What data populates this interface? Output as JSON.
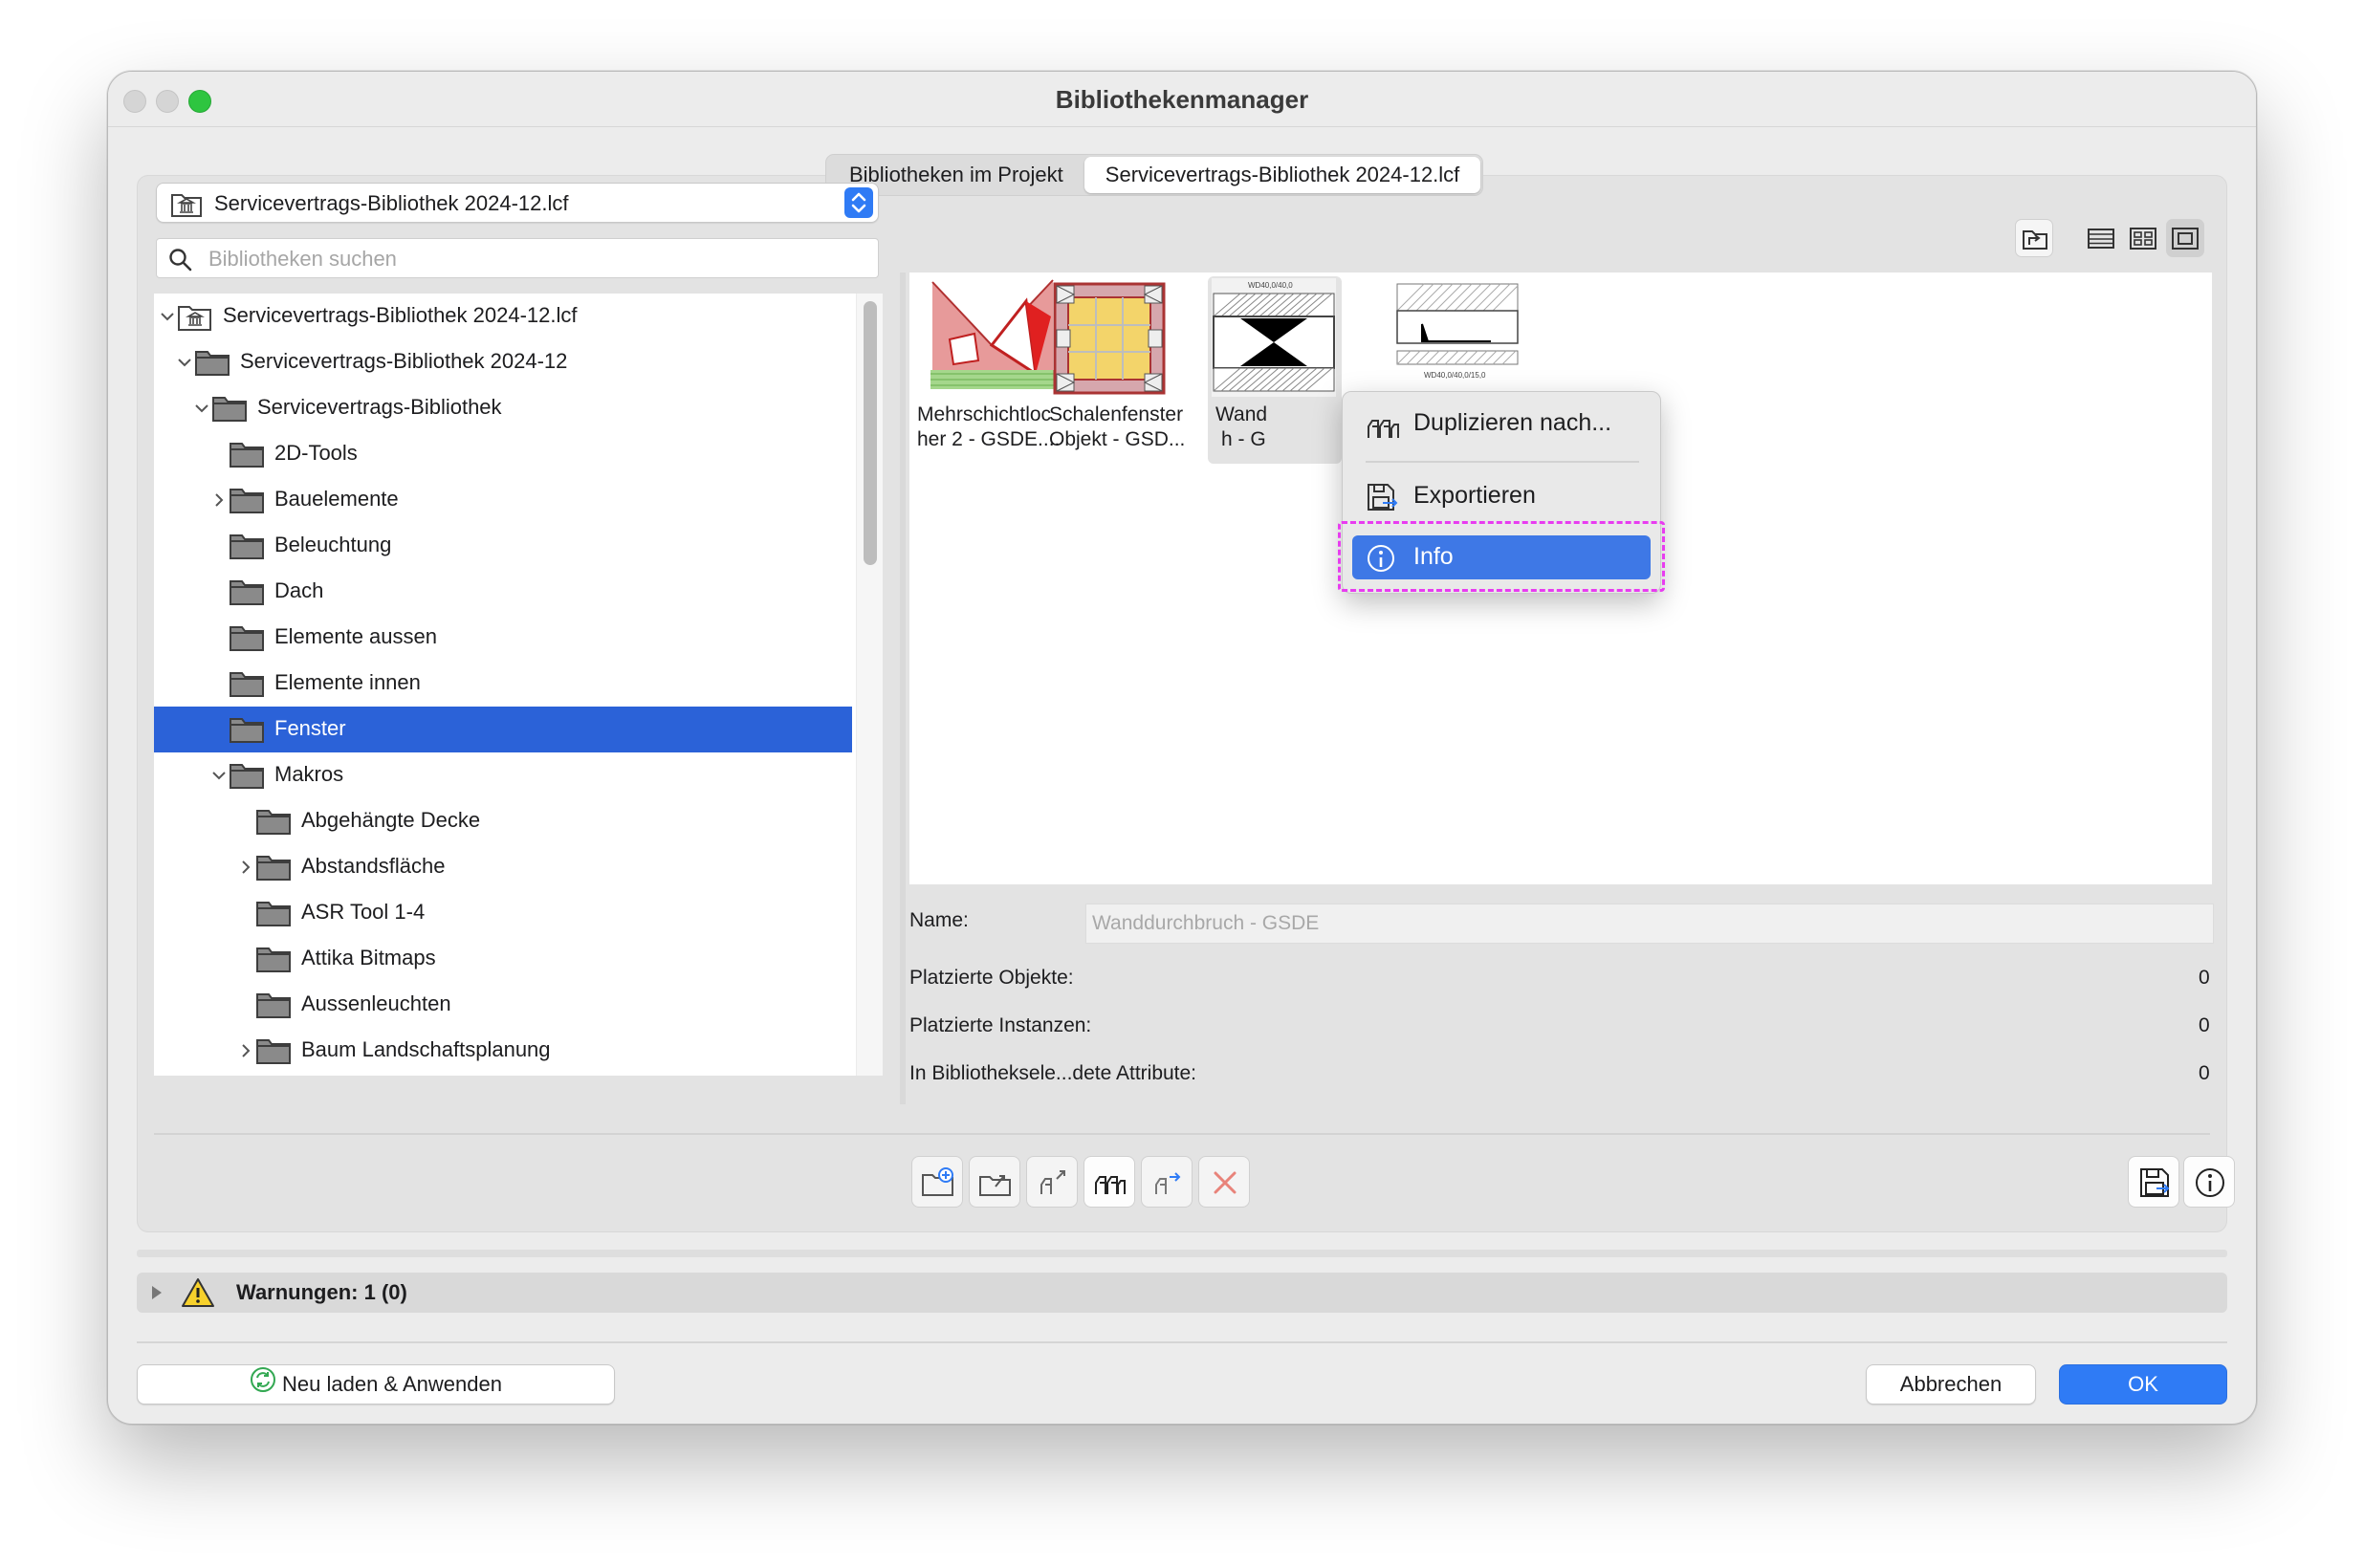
{
  "window": {
    "title": "Bibliothekenmanager"
  },
  "tabs": [
    {
      "label": "Bibliotheken im Projekt",
      "active": false
    },
    {
      "label": "Servicevertrags-Bibliothek 2024-12.lcf",
      "active": true
    }
  ],
  "library_select": {
    "value": "Servicevertrags-Bibliothek 2024-12.lcf"
  },
  "search": {
    "placeholder": "Bibliotheken suchen"
  },
  "tree": {
    "items": [
      {
        "label": "Servicevertrags-Bibliothek 2024-12.lcf",
        "expanded": true,
        "icon": "library-icon"
      },
      {
        "label": "Servicevertrags-Bibliothek 2024-12",
        "expanded": true,
        "icon": "folder-icon"
      },
      {
        "label": "Servicevertrags-Bibliothek",
        "expanded": true,
        "icon": "folder-icon"
      },
      {
        "label": "2D-Tools",
        "icon": "folder-icon"
      },
      {
        "label": "Bauelemente",
        "expanded": false,
        "icon": "folder-icon"
      },
      {
        "label": "Beleuchtung",
        "icon": "folder-icon"
      },
      {
        "label": "Dach",
        "icon": "folder-icon"
      },
      {
        "label": "Elemente aussen",
        "icon": "folder-icon"
      },
      {
        "label": "Elemente innen",
        "icon": "folder-icon"
      },
      {
        "label": "Fenster",
        "selected": true,
        "icon": "folder-icon"
      },
      {
        "label": "Makros",
        "expanded": true,
        "icon": "folder-icon"
      },
      {
        "label": "Abgehängte Decke",
        "icon": "folder-icon"
      },
      {
        "label": "Abstandsfläche",
        "expanded": false,
        "icon": "folder-icon"
      },
      {
        "label": "ASR Tool 1-4",
        "icon": "folder-icon"
      },
      {
        "label": "Attika Bitmaps",
        "icon": "folder-icon"
      },
      {
        "label": "Aussenleuchten",
        "icon": "folder-icon"
      },
      {
        "label": "Baum Landschaftsplanung",
        "expanded": false,
        "icon": "folder-icon"
      }
    ]
  },
  "view_buttons": [
    "folder-up-icon",
    "list-view-icon",
    "grid-view-icon",
    "preview-view-icon"
  ],
  "preview": {
    "items": [
      {
        "caption_line1": "Mehrschichtloc",
        "caption_line2": "her 2 - GSDE....",
        "thumb_label": ""
      },
      {
        "caption_line1": "Schalenfenster",
        "caption_line2": "Objekt - GSD...",
        "thumb_label": ""
      },
      {
        "caption_line1": "Wand",
        "caption_line2": "h  - G",
        "thumb_label": "WD40,0/40,0"
      },
      {
        "caption_line1": "",
        "caption_line2": "",
        "thumb_label": "WD40,0/40,0/15,0"
      }
    ]
  },
  "context_menu": {
    "items": [
      {
        "label": "Duplizieren nach...",
        "icon": "duplicate-icon"
      },
      {
        "label": "Exportieren",
        "icon": "export-icon"
      },
      {
        "label": "Info",
        "icon": "info-icon",
        "highlighted": true
      }
    ]
  },
  "details": {
    "name_label": "Name:",
    "name_value": "Wanddurchbruch  - GSDE",
    "rows": [
      {
        "label": "Platzierte Objekte:",
        "value": "0"
      },
      {
        "label": "Platzierte Instanzen:",
        "value": "0"
      },
      {
        "label": "In Bibliotheksele...dete Attribute:",
        "value": "0"
      }
    ]
  },
  "toolbar": {
    "buttons": [
      "new-folder-icon",
      "open-folder-icon",
      "move-objects-icon",
      "duplicate-objects-icon",
      "move-to-icon",
      "delete-icon"
    ],
    "right_buttons": [
      "save-export-icon",
      "info-icon"
    ]
  },
  "warnings": {
    "label": "Warnungen: 1 (0)"
  },
  "footer": {
    "reload_label": "Neu laden & Anwenden",
    "cancel_label": "Abbrechen",
    "ok_label": "OK"
  },
  "colors": {
    "accent": "#2f7bf5",
    "selection": "#2b62d8",
    "menu_highlight": "#3e78e6",
    "annotation": "#e83cf0"
  }
}
